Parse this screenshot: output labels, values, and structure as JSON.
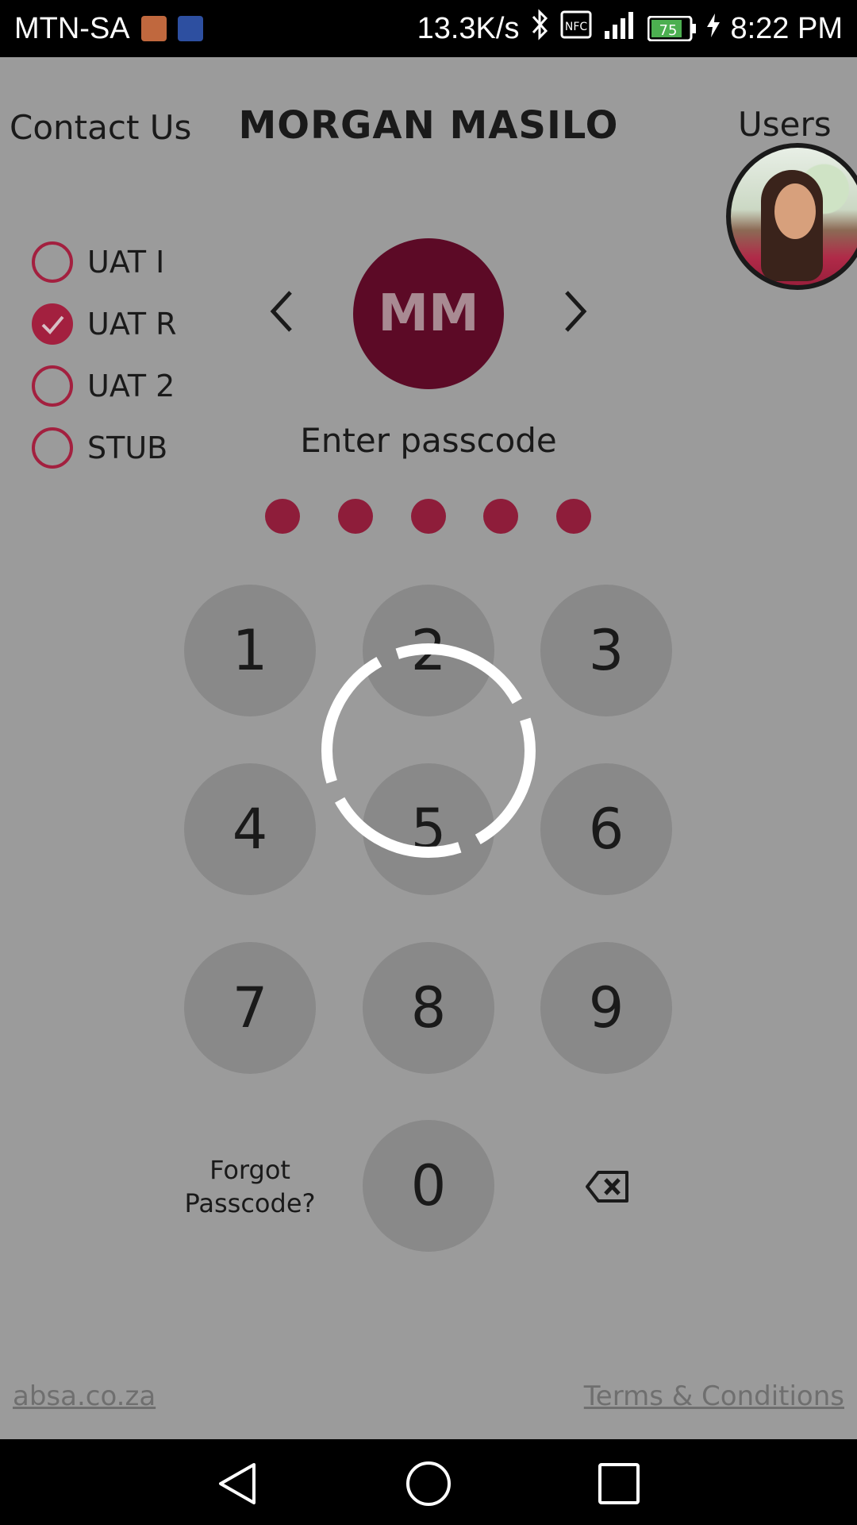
{
  "status_bar": {
    "carrier": "MTN-SA",
    "speed": "13.3K/s",
    "battery": "75",
    "time": "8:22 PM"
  },
  "header": {
    "contact": "Contact Us",
    "name": "MORGAN MASILO",
    "users": "Users"
  },
  "environments": [
    {
      "label": "UAT I",
      "checked": false
    },
    {
      "label": "UAT R",
      "checked": true
    },
    {
      "label": "UAT 2",
      "checked": false
    },
    {
      "label": "STUB",
      "checked": false
    }
  ],
  "profile": {
    "initials": "MM"
  },
  "passcode": {
    "prompt": "Enter passcode",
    "digits_entered": 5,
    "keys": [
      "1",
      "2",
      "3",
      "4",
      "5",
      "6",
      "7",
      "8",
      "9",
      "0"
    ],
    "forgot_line1": "Forgot",
    "forgot_line2": "Passcode?"
  },
  "footer": {
    "site": "absa.co.za",
    "terms": "Terms & Conditions"
  },
  "colors": {
    "accent": "#a3203f",
    "profile_bg": "#5c0a26",
    "overlay_bg": "#9b9b9b"
  }
}
